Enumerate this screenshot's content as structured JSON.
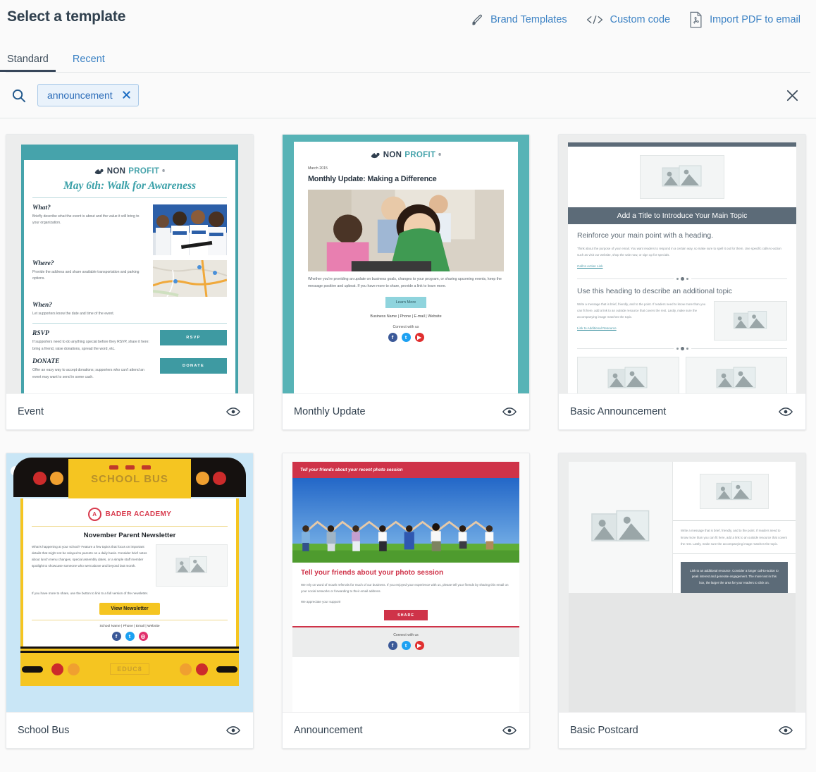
{
  "header": {
    "title": "Select a template",
    "actions": [
      {
        "label": "Brand Templates",
        "icon": "paintbrush-icon"
      },
      {
        "label": "Custom code",
        "icon": "code-icon"
      },
      {
        "label": "Import PDF to email",
        "icon": "pdf-file-icon"
      }
    ]
  },
  "tabs": [
    {
      "label": "Standard",
      "active": true
    },
    {
      "label": "Recent",
      "active": false
    }
  ],
  "search": {
    "icon": "search-icon",
    "chip_label": "announcement",
    "chip_remove_icon": "x-icon",
    "close_icon": "close-icon"
  },
  "cards": [
    {
      "title": "Event",
      "preview_icon": "eye-icon"
    },
    {
      "title": "Monthly Update",
      "preview_icon": "eye-icon"
    },
    {
      "title": "Basic Announcement",
      "preview_icon": "eye-icon"
    },
    {
      "title": "School Bus",
      "preview_icon": "eye-icon"
    },
    {
      "title": "Announcement",
      "preview_icon": "eye-icon"
    },
    {
      "title": "Basic Postcard",
      "preview_icon": "eye-icon"
    }
  ],
  "previews": {
    "event": {
      "logo_non": "NON",
      "logo_pro": "PROFIT",
      "headline": "May 6th: Walk for Awareness",
      "s1_title": "What?",
      "s1_body": "Briefly describe what the event is about and the value it will bring to your organization.",
      "s2_title": "Where?",
      "s2_body": "Provide the address and share available transportation and parking options.",
      "s3_title": "When?",
      "s3_body": "Let supporters know the date and time of the event.",
      "s4_title": "RSVP",
      "s4_body": "If supporters need to do anything special before they RSVP, share it here: bring a friend, raise donations, spread the word, etc.",
      "s4_button": "RSVP",
      "s5_title": "DONATE",
      "s5_body": "Offer an easy way to accept donations; supporters who can't attend an event may want to send in some cash.",
      "s5_button": "DONATE"
    },
    "monthly_update": {
      "logo_non": "NON",
      "logo_pro": "PROFIT",
      "date": "March 2015",
      "headline": "Monthly Update: Making a Difference",
      "body": "Whether you're providing an update on business goals, changes to your program, or sharing upcoming events, keep the message positive and upbeat. If you have more to share, provide a link to learn more.",
      "button": "Learn More",
      "footer_links": "Business Name | Phone | E-mail | Website",
      "connect": "Connect with us"
    },
    "basic_announcement": {
      "title_bar": "Add a Title to Introduce Your Main Topic",
      "heading1": "Reinforce your main point with a heading.",
      "body1": "Think about the purpose of your email. You want readers to respond in a certain way, so make sure to spell it out for them. Use specific calls-to-action such as visit our website, shop the sale now, or sign up for specials.",
      "link1": "Call to Action Link",
      "heading2": "Use this heading to describe an additional topic",
      "body2": "Write a message that is brief, friendly, and to the point. If readers need to know more than you can fit here, add a link to an outside resource that covers the rest. Lastly, make sure the accompanying image matches the topic.",
      "link2": "Link to Additional Resource"
    },
    "school_bus": {
      "bus_sign": "SCHOOL BUS",
      "school_name": "BADER ACADEMY",
      "badge_letter": "A",
      "headline": "November Parent Newsletter",
      "body1": "What's happening at your school? Feature a few topics that focus on important details that might not be relayed to parents on a daily basis. Consider brief notes about lunch menu changes, special assembly dates, or a simple staff member spotlight to showcase someone who went above and beyond last month.",
      "body2": "If you have more to share, use the button to link to a full version of the newsletter.",
      "button": "View Newsletter",
      "footer_links": "School Name | Phone | Email | Website",
      "plate": "EDUC8"
    },
    "announcement": {
      "band": "Tell your friends about your recent photo session",
      "headline": "Tell your friends about your photo session",
      "body1": "We rely on word of mouth referrals for much of our business. If you enjoyed your experience with us, please tell your friends by sharing this email on your social networks or forwarding to their email address.",
      "body2": "We appreciate your support!",
      "button": "SHARE",
      "connect": "Connect with us"
    },
    "basic_postcard": {
      "body": "Write a message that is brief, friendly, and to the point. If readers need to know more than you can fit here, add a link to an outside resource that covers the rest. Lastly, make sure the accompanying image matches the topic.",
      "cta": "Link to an additional resource. Consider a longer call-to-action to peak interest and generate engagement. The more text in this box, the larger the area for your readers to click on."
    }
  },
  "colors": {
    "link": "#3c82c4",
    "teal": "#46a3ab",
    "teal_frame": "#57b3b6",
    "slate": "#5c6b78",
    "bus_yellow": "#f5c521",
    "red": "#cf3349",
    "page_bg": "#fafafa"
  }
}
